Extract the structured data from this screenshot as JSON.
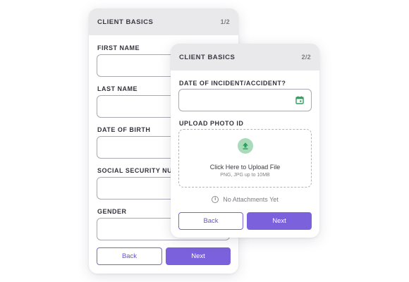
{
  "card1": {
    "title": "CLIENT BASICS",
    "step": "1/2",
    "fields": [
      {
        "label": "FIRST NAME",
        "value": ""
      },
      {
        "label": "LAST NAME",
        "value": ""
      },
      {
        "label": "DATE OF BIRTH",
        "value": ""
      },
      {
        "label": "SOCIAL SECURITY NUMBER",
        "value": ""
      },
      {
        "label": "GENDER",
        "value": ""
      }
    ],
    "back_label": "Back",
    "next_label": "Next"
  },
  "card2": {
    "title": "CLIENT BASICS",
    "step": "2/2",
    "date_label": "DATE OF INCIDENT/ACCIDENT?",
    "date_value": "",
    "date_icon": "calendar-icon",
    "upload_label": "UPLOAD PHOTO ID",
    "upload_icon": "upload-arrow-icon",
    "upload_title": "Click Here to Upload File",
    "upload_hint": "PNG, JPG up to 10MB",
    "attachments_icon": "info-icon",
    "attachments_status": "No Attachments Yet",
    "back_label": "Back",
    "next_label": "Next"
  },
  "colors": {
    "accent": "#7b62dc",
    "header_bg": "#e9e9ec",
    "upload_accent": "#2f9e5c",
    "upload_accent_bg": "#a9dbbb",
    "calendar_green": "#2f9e5c"
  }
}
